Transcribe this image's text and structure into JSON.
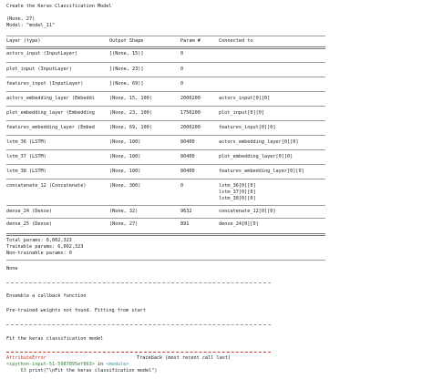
{
  "header": {
    "title": "Create the Keras Classification Model",
    "shape": "(None, 27)",
    "model": "Model: \"model_11\""
  },
  "table": {
    "columns": [
      "Layer (type)",
      "Output Shape",
      "Param #",
      "Connected to"
    ],
    "rows": [
      {
        "layer": "actors_input (InputLayer)",
        "shape": "[(None, 15)]",
        "params": "0",
        "conn": [
          ""
        ]
      },
      {
        "layer": "plot_input (InputLayer)",
        "shape": "[(None, 23)]",
        "params": "0",
        "conn": [
          ""
        ]
      },
      {
        "layer": "features_input (InputLayer)",
        "shape": "[(None, 69)]",
        "params": "0",
        "conn": [
          ""
        ]
      },
      {
        "layer": "actors_embedding_layer (Embeddi",
        "shape": "(None, 15, 100)",
        "params": "2000200",
        "conn": [
          "actors_input[0][0]"
        ]
      },
      {
        "layer": "plot_embedding_layer (Embedding",
        "shape": "(None, 23, 100)",
        "params": "1750200",
        "conn": [
          "plot_input[0][0]"
        ]
      },
      {
        "layer": "features_embedding_layer (Embed",
        "shape": "(None, 69, 100)",
        "params": "2000200",
        "conn": [
          "features_input[0][0]"
        ]
      },
      {
        "layer": "lstm_36 (LSTM)",
        "shape": "(None, 100)",
        "params": "80400",
        "conn": [
          "actors_embedding_layer[0][0]"
        ]
      },
      {
        "layer": "lstm_37 (LSTM)",
        "shape": "(None, 100)",
        "params": "80400",
        "conn": [
          "plot_embedding_layer[0][0]"
        ]
      },
      {
        "layer": "lstm_38 (LSTM)",
        "shape": "(None, 100)",
        "params": "80400",
        "conn": [
          "features_embedding_layer[0][0]"
        ]
      },
      {
        "layer": "concatenate_12 (Concatenate)",
        "shape": "(None, 300)",
        "params": "0",
        "conn": [
          "lstm_36[0][0]",
          "lstm_37[0][0]",
          "lstm_38[0][0]"
        ]
      },
      {
        "layer": "dense_24 (Dense)",
        "shape": "(None, 32)",
        "params": "9632",
        "conn": [
          "concatenate_12[0][0]"
        ]
      },
      {
        "layer": "dense_25 (Dense)",
        "shape": "(None, 27)",
        "params": "891",
        "conn": [
          "dense_24[0][0]"
        ]
      }
    ]
  },
  "summary": {
    "total": "Total params: 6,002,323",
    "trainable": "Trainable params: 6,002,323",
    "non_trainable": "Non-trainable params: 0"
  },
  "return_value": "None",
  "callback_section": {
    "title": "Ensemble a callback function",
    "message": "Pre-trained weights not found. Fitting from start"
  },
  "fit_section": {
    "title": "Fit the keras classification model"
  },
  "traceback": {
    "error_name": "AttributeError",
    "trace_header": "Traceback (most recent call last)",
    "input_ref": "<ipython-input-51-5987895ef863>",
    "in_word": " in ",
    "module": "<module>",
    "line_no": "     63 ",
    "line_code": "print(\"\\nFit the keras classification model\")"
  },
  "colors": {
    "error": "#c0392b",
    "ipython_ref": "#2e7d32",
    "module": "#2a8fa0",
    "rule": "#9a9a9a"
  }
}
